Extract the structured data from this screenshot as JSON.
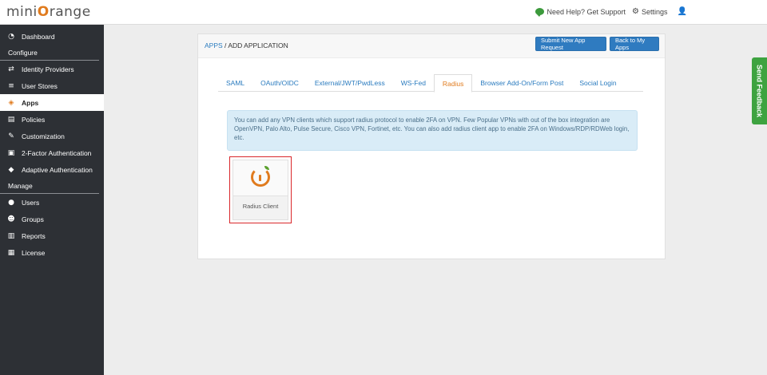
{
  "brand": {
    "logo_prefix": "mini",
    "logo_o": "O",
    "logo_suffix": "range"
  },
  "header": {
    "help_label": "Need Help? Get Support",
    "settings_label": "Settings"
  },
  "sidebar": {
    "items_top": [
      {
        "label": "Dashboard",
        "icon": "dashboard-icon",
        "glyph": "◔"
      }
    ],
    "section_configure": "Configure",
    "items_configure": [
      {
        "label": "Identity Providers",
        "icon": "exchange-icon",
        "glyph": "⇄"
      },
      {
        "label": "User Stores",
        "icon": "database-icon",
        "glyph": "≡"
      },
      {
        "label": "Apps",
        "icon": "cube-icon",
        "glyph": "◈",
        "active": true
      },
      {
        "label": "Policies",
        "icon": "file-icon",
        "glyph": "▤"
      },
      {
        "label": "Customization",
        "icon": "wrench-icon",
        "glyph": "✎"
      },
      {
        "label": "2-Factor Authentication",
        "icon": "lock-icon",
        "glyph": "▣"
      },
      {
        "label": "Adaptive Authentication",
        "icon": "shield-icon",
        "glyph": "◆"
      }
    ],
    "section_manage": "Manage",
    "items_manage": [
      {
        "label": "Users",
        "icon": "user-icon",
        "glyph": "●"
      },
      {
        "label": "Groups",
        "icon": "users-icon",
        "glyph": "☻"
      },
      {
        "label": "Reports",
        "icon": "chart-icon",
        "glyph": "▥"
      },
      {
        "label": "License",
        "icon": "license-icon",
        "glyph": "▦"
      }
    ]
  },
  "breadcrumb": {
    "root": "APPS",
    "separator": " / ",
    "current": "ADD APPLICATION"
  },
  "buttons": {
    "submit": "Submit New App Request",
    "back": "Back to My Apps"
  },
  "tabs": [
    {
      "label": "SAML"
    },
    {
      "label": "OAuth/OIDC"
    },
    {
      "label": "External/JWT/PwdLess"
    },
    {
      "label": "WS-Fed"
    },
    {
      "label": "Radius",
      "active": true
    },
    {
      "label": "Browser Add-On/Form Post"
    },
    {
      "label": "Social Login"
    }
  ],
  "info_text": "You can add any VPN clients which support radius protocol to enable 2FA on VPN. Few Popular VPNs with out of the box integration are OpenVPN, Palo Alto, Pulse Secure, Cisco VPN, Fortinet, etc. You can also add radius client app to enable 2FA on Windows/RDP/RDWeb login, etc.",
  "app_card": {
    "name": "Radius Client"
  },
  "feedback": {
    "label": "Send Feedback"
  },
  "colors": {
    "accent": "#e07b1e",
    "link": "#2a7bbf",
    "button": "#2f7bc0",
    "sidebar": "#2d3035",
    "feedback": "#3ea340",
    "highlight": "#d9262a"
  }
}
